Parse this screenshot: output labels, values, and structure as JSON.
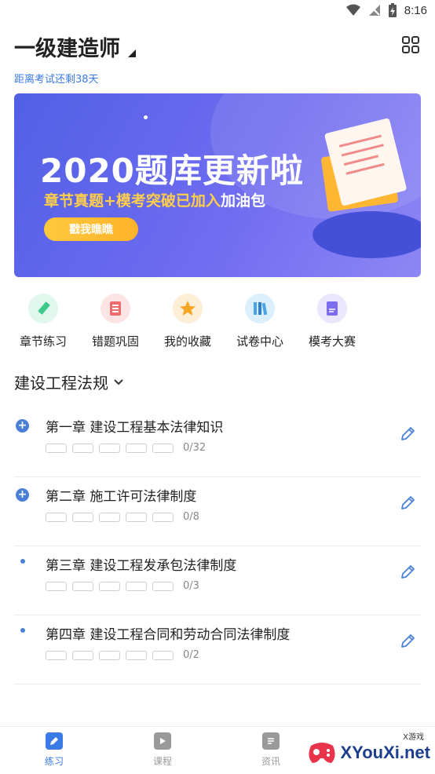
{
  "status_bar": {
    "time": "8:16",
    "icons": [
      "wifi-icon",
      "no-signal-icon",
      "battery-charging-icon"
    ]
  },
  "header": {
    "title": "一级建造师",
    "countdown": "距离考试还剩38天",
    "grid_icon": "grid-icon"
  },
  "banner": {
    "title": "2020题库更新啦",
    "subtitle_part1": "章节真题+模考突破",
    "subtitle_highlight": "已加入",
    "subtitle_part2": "加油包",
    "button": "戳我瞧瞧"
  },
  "quick_nav": [
    {
      "label": "章节练习",
      "icon": "pencil-icon",
      "color": "#3ec98a",
      "bg": "#dff7ec"
    },
    {
      "label": "错题巩固",
      "icon": "notebook-icon",
      "color": "#ef6b6b",
      "bg": "#fde4e4"
    },
    {
      "label": "我的收藏",
      "icon": "star-icon",
      "color": "#f5a623",
      "bg": "#fdeed6"
    },
    {
      "label": "试卷中心",
      "icon": "books-icon",
      "color": "#4aa3e8",
      "bg": "#dceffd"
    },
    {
      "label": "模考大赛",
      "icon": "exam-paper-icon",
      "color": "#7b6cf0",
      "bg": "#e9e6fd"
    }
  ],
  "subject": {
    "label": "建设工程法规"
  },
  "chapters": [
    {
      "title": "第一章 建设工程基本法律知识",
      "count": "0/32",
      "marker": "plus"
    },
    {
      "title": "第二章 施工许可法律制度",
      "count": "0/8",
      "marker": "plus"
    },
    {
      "title": " 第三章 建设工程发承包法律制度",
      "count": "0/3",
      "marker": "dot"
    },
    {
      "title": "第四章 建设工程合同和劳动合同法律制度",
      "count": "0/2",
      "marker": "dot"
    }
  ],
  "bottom_nav": [
    {
      "label": "练习",
      "active": true
    },
    {
      "label": "课程",
      "active": false
    },
    {
      "label": "资讯",
      "active": false
    }
  ],
  "watermark": {
    "text": "XYouXi.net",
    "small": "X游戏"
  },
  "colors": {
    "accent": "#3b7be6",
    "banner": "#5f66ea",
    "inactive": "#9a9a9a"
  }
}
